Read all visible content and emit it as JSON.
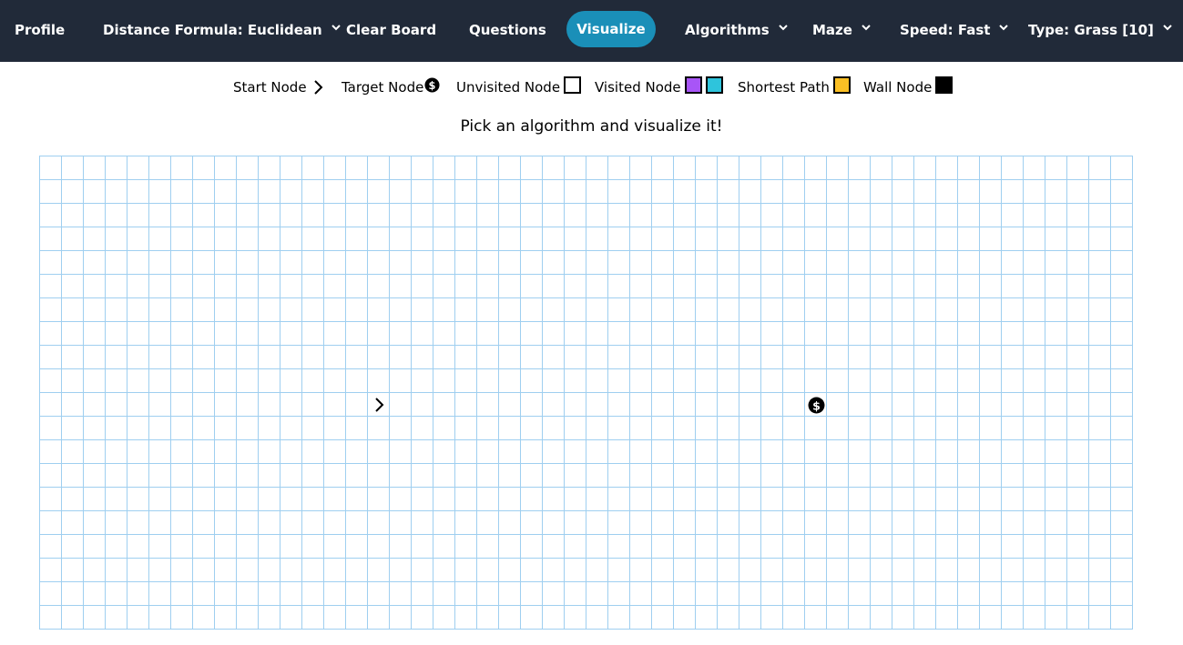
{
  "navbar": {
    "profile": "Profile",
    "distance": "Distance Formula: Euclidean",
    "clear": "Clear Board",
    "questions": "Questions",
    "visualize": "Visualize",
    "algorithms": "Algorithms",
    "maze": "Maze",
    "speed": "Speed: Fast",
    "type": "Type: Grass [10]"
  },
  "legend": {
    "start": "Start Node",
    "target": "Target Node",
    "unvisited": "Unvisited Node",
    "visited": "Visited Node",
    "shortest": "Shortest Path",
    "wall": "Wall Node"
  },
  "colors": {
    "navbar_bg": "#212a39",
    "active_button": "#1a8fb8",
    "grid_line": "#9fcff0",
    "visited_a": "#a855f7",
    "visited_b": "#2ec4dc",
    "shortest_path": "#fbbf24",
    "wall": "#000000"
  },
  "subtitle": "Pick an algorithm and visualize it!",
  "grid": {
    "rows": 20,
    "cols": 50,
    "start": {
      "row": 10,
      "col": 15,
      "icon": "chevron-right-icon"
    },
    "target": {
      "row": 10,
      "col": 35,
      "icon": "dollar-coin-icon"
    }
  }
}
